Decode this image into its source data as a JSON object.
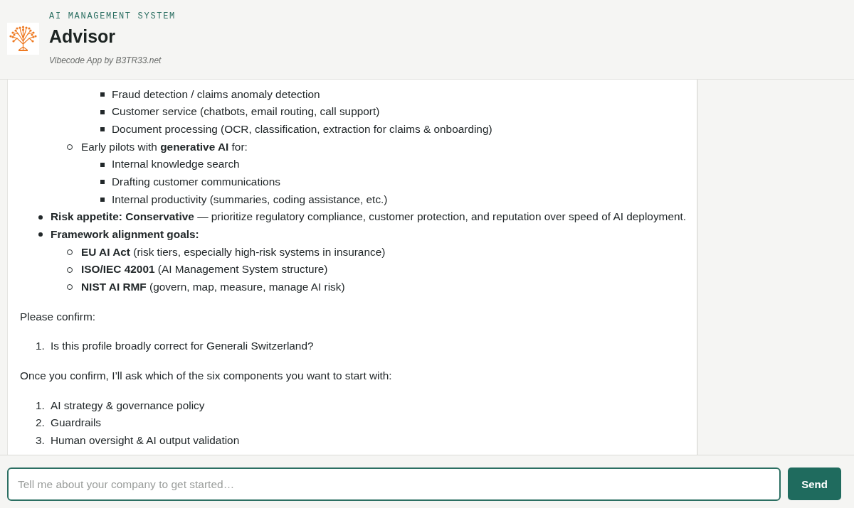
{
  "header": {
    "eyebrow": "AI MANAGEMENT SYSTEM",
    "title": "Advisor",
    "subtitle": "Vibecode App by B3TR33.net"
  },
  "conversation": {
    "blocks": [
      {
        "kind": "bullet_list",
        "items": [
          {
            "children": [
              {
                "children": [
                  {
                    "text": "Fraud detection / claims anomaly detection"
                  },
                  {
                    "text": "Customer service (chatbots, email routing, call support)"
                  },
                  {
                    "text": "Document processing (OCR, classification, extraction for claims & onboarding)"
                  }
                ]
              },
              {
                "text": "Early pilots with **generative AI** for:",
                "children": [
                  {
                    "text": "Internal knowledge search"
                  },
                  {
                    "text": "Drafting customer communications"
                  },
                  {
                    "text": "Internal productivity (summaries, coding assistance, etc.)"
                  }
                ]
              }
            ]
          },
          {
            "text": "**Risk appetite: Conservative** — prioritize regulatory compliance, customer protection, and reputation over speed of AI deployment."
          },
          {
            "text": "**Framework alignment goals:**",
            "children": [
              {
                "text": "**EU AI Act** (risk tiers, especially high-risk systems in insurance)"
              },
              {
                "text": "**ISO/IEC 42001** (AI Management System structure)"
              },
              {
                "text": "**NIST AI RMF** (govern, map, measure, manage AI risk)"
              }
            ]
          }
        ]
      },
      {
        "kind": "paragraph",
        "text": "Please confirm:"
      },
      {
        "kind": "numbered_list",
        "items": [
          {
            "number": "1.",
            "text": "Is this profile broadly correct for Generali Switzerland?"
          }
        ]
      },
      {
        "kind": "paragraph",
        "text": "Once you confirm, I’ll ask which of the six components you want to start with:"
      },
      {
        "kind": "numbered_list",
        "items": [
          {
            "number": "1.",
            "text": "AI strategy & governance policy"
          },
          {
            "number": "2.",
            "text": "Guardrails"
          },
          {
            "number": "3.",
            "text": "Human oversight & AI output validation"
          }
        ]
      }
    ]
  },
  "composer": {
    "placeholder": "Tell me about your company to get started…",
    "button": "Send"
  }
}
